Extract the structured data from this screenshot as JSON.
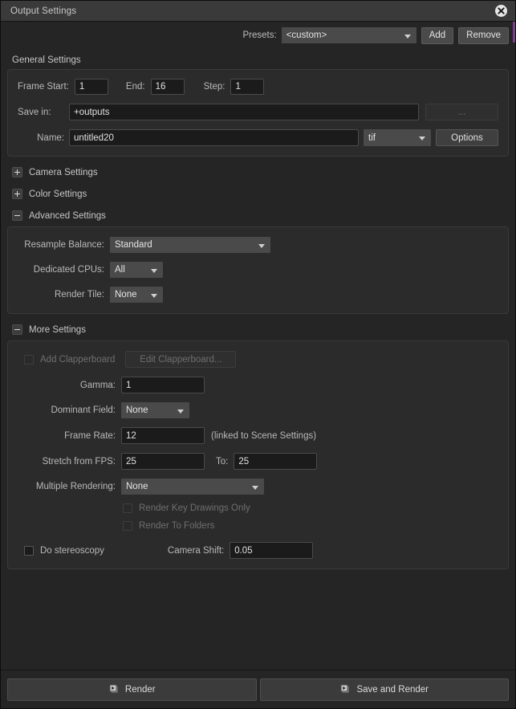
{
  "window": {
    "title": "Output Settings",
    "close_icon": "close-circle-icon",
    "accent_color": "#7a3f8e"
  },
  "presets": {
    "label": "Presets:",
    "value": "<custom>",
    "add_label": "Add",
    "remove_label": "Remove"
  },
  "general": {
    "title": "General Settings",
    "frame_start_label": "Frame Start:",
    "frame_start_value": "1",
    "end_label": "End:",
    "end_value": "16",
    "step_label": "Step:",
    "step_value": "1",
    "save_in_label": "Save in:",
    "save_in_value": "+outputs",
    "browse_label": "...",
    "name_label": "Name:",
    "name_value": "untitled20",
    "format_value": "tif",
    "options_label": "Options"
  },
  "camera": {
    "title": "Camera Settings",
    "expanded": false
  },
  "color": {
    "title": "Color Settings",
    "expanded": false
  },
  "advanced": {
    "title": "Advanced Settings",
    "expanded": true,
    "resample_label": "Resample Balance:",
    "resample_value": "Standard",
    "cpus_label": "Dedicated CPUs:",
    "cpus_value": "All",
    "tile_label": "Render Tile:",
    "tile_value": "None"
  },
  "more": {
    "title": "More Settings",
    "expanded": true,
    "add_clapperboard_label": "Add Clapperboard",
    "edit_clapperboard_label": "Edit Clapperboard...",
    "gamma_label": "Gamma:",
    "gamma_value": "1",
    "dominant_field_label": "Dominant Field:",
    "dominant_field_value": "None",
    "frame_rate_label": "Frame Rate:",
    "frame_rate_value": "12",
    "frame_rate_note": "(linked to Scene Settings)",
    "stretch_label": "Stretch from FPS:",
    "stretch_value": "25",
    "to_label": "To:",
    "to_value": "25",
    "multiple_rendering_label": "Multiple Rendering:",
    "multiple_rendering_value": "None",
    "render_key_label": "Render Key Drawings Only",
    "render_folders_label": "Render To Folders",
    "stereoscopy_label": "Do stereoscopy",
    "camera_shift_label": "Camera Shift:",
    "camera_shift_value": "0.05"
  },
  "footer": {
    "render_label": "Render",
    "save_render_label": "Save and Render",
    "render_icon": "render-frames-icon"
  }
}
